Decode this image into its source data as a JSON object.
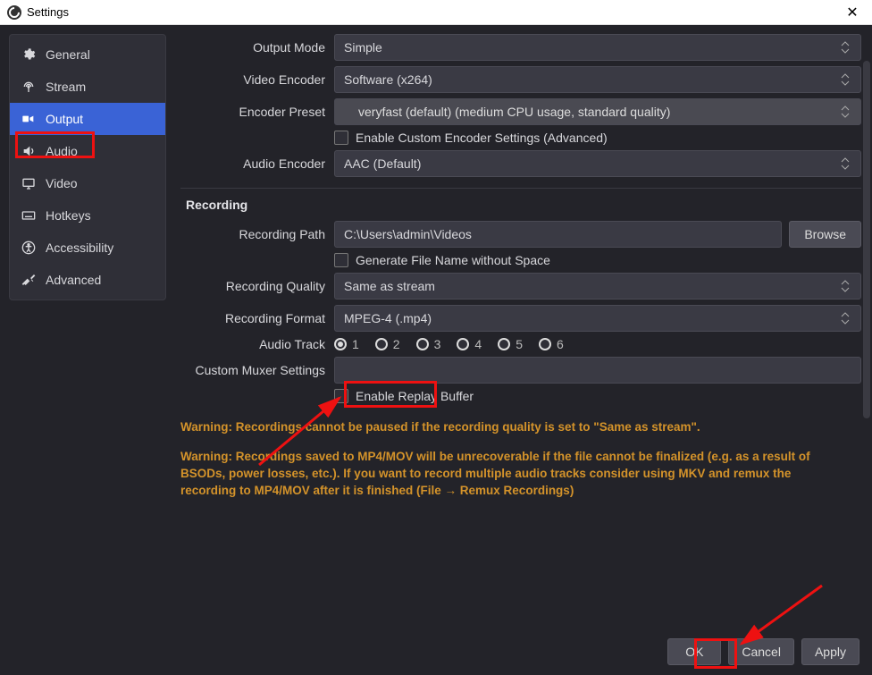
{
  "window": {
    "title": "Settings"
  },
  "sidebar": {
    "items": [
      {
        "label": "General"
      },
      {
        "label": "Stream"
      },
      {
        "label": "Output"
      },
      {
        "label": "Audio"
      },
      {
        "label": "Video"
      },
      {
        "label": "Hotkeys"
      },
      {
        "label": "Accessibility"
      },
      {
        "label": "Advanced"
      }
    ]
  },
  "labels": {
    "output_mode": "Output Mode",
    "video_encoder": "Video Encoder",
    "encoder_preset": "Encoder Preset",
    "enable_custom": "Enable Custom Encoder Settings (Advanced)",
    "audio_encoder": "Audio Encoder",
    "recording_section": "Recording",
    "recording_path": "Recording Path",
    "browse": "Browse",
    "gen_no_space": "Generate File Name without Space",
    "recording_quality": "Recording Quality",
    "recording_format": "Recording Format",
    "audio_track": "Audio Track",
    "custom_muxer": "Custom Muxer Settings",
    "enable_replay": "Enable Replay Buffer"
  },
  "values": {
    "output_mode": "Simple",
    "video_encoder": "Software (x264)",
    "encoder_preset": "veryfast (default) (medium CPU usage, standard quality)",
    "audio_encoder": "AAC (Default)",
    "recording_path": "C:\\Users\\admin\\Videos",
    "recording_quality": "Same as stream",
    "recording_format": "MPEG-4 (.mp4)",
    "custom_muxer": ""
  },
  "audio_tracks": [
    "1",
    "2",
    "3",
    "4",
    "5",
    "6"
  ],
  "warnings": {
    "w1": "Warning: Recordings cannot be paused if the recording quality is set to \"Same as stream\".",
    "w2": "Warning: Recordings saved to MP4/MOV will be unrecoverable if the file cannot be finalized (e.g. as a result of BSODs, power losses, etc.). If you want to record multiple audio tracks consider using MKV and remux the recording to MP4/MOV after it is finished (File → Remux Recordings)"
  },
  "footer": {
    "ok": "OK",
    "cancel": "Cancel",
    "apply": "Apply"
  }
}
